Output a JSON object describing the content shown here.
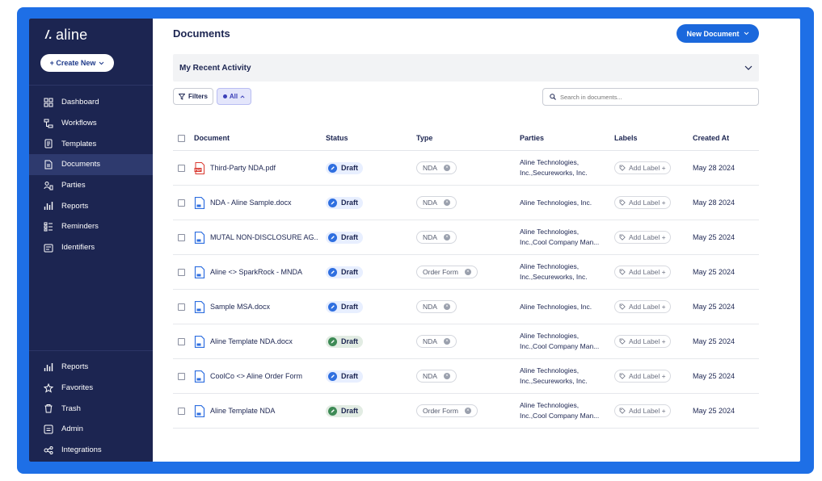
{
  "brand": {
    "name": "aline",
    "mark": "/."
  },
  "sidebar": {
    "create_label": "+ Create New",
    "top_items": [
      {
        "label": "Dashboard",
        "icon": "dashboard-icon",
        "active": false
      },
      {
        "label": "Workflows",
        "icon": "workflow-icon",
        "active": false
      },
      {
        "label": "Templates",
        "icon": "template-icon",
        "active": false
      },
      {
        "label": "Documents",
        "icon": "document-icon",
        "active": true
      },
      {
        "label": "Parties",
        "icon": "parties-icon",
        "active": false
      },
      {
        "label": "Reports",
        "icon": "reports-icon",
        "active": false
      },
      {
        "label": "Reminders",
        "icon": "reminders-icon",
        "active": false
      },
      {
        "label": "Identifiers",
        "icon": "identifiers-icon",
        "active": false
      }
    ],
    "bottom_items": [
      {
        "label": "Reports",
        "icon": "reports-icon"
      },
      {
        "label": "Favorites",
        "icon": "star-icon"
      },
      {
        "label": "Trash",
        "icon": "trash-icon"
      },
      {
        "label": "Admin",
        "icon": "admin-icon"
      },
      {
        "label": "Integrations",
        "icon": "integrations-icon"
      }
    ]
  },
  "header": {
    "title": "Documents",
    "new_doc_label": "New Document"
  },
  "recent": {
    "title": "My Recent Activity"
  },
  "toolbar": {
    "filters_label": "Filters",
    "all_label": "All",
    "search_placeholder": "Search in documents..."
  },
  "table": {
    "columns": [
      "Document",
      "Status",
      "Type",
      "Parties",
      "Labels",
      "Created At"
    ],
    "rows": [
      {
        "name": "Third-Party NDA.pdf",
        "file": "pdf",
        "status": "Draft",
        "status_color": "blue",
        "type": "NDA",
        "parties": [
          "Aline Technologies,",
          "Inc.,Secureworks, Inc."
        ],
        "label": "Add Label +",
        "created": "May 28 2024"
      },
      {
        "name": "NDA - Aline Sample.docx",
        "file": "doc",
        "status": "Draft",
        "status_color": "blue",
        "type": "NDA",
        "parties": [
          "Aline Technologies, Inc."
        ],
        "label": "Add Label +",
        "created": "May 28 2024"
      },
      {
        "name": "MUTAL NON-DISCLOSURE AG..",
        "file": "doc",
        "status": "Draft",
        "status_color": "blue",
        "type": "NDA",
        "parties": [
          "Aline Technologies,",
          "Inc.,Cool Company Man..."
        ],
        "label": "Add Label +",
        "created": "May 25 2024"
      },
      {
        "name": "Aline <> SparkRock - MNDA",
        "file": "doc",
        "status": "Draft",
        "status_color": "blue",
        "type": "Order Form",
        "parties": [
          "Aline Technologies,",
          "Inc.,Secureworks, Inc."
        ],
        "label": "Add Label +",
        "created": "May 25 2024"
      },
      {
        "name": "Sample MSA.docx",
        "file": "doc",
        "status": "Draft",
        "status_color": "blue",
        "type": "NDA",
        "parties": [
          "Aline Technologies, Inc."
        ],
        "label": "Add Label +",
        "created": "May 25 2024"
      },
      {
        "name": "Aline Template NDA.docx",
        "file": "doc",
        "status": "Draft",
        "status_color": "green",
        "type": "NDA",
        "parties": [
          "Aline Technologies,",
          "Inc.,Cool Company Man..."
        ],
        "label": "Add Label +",
        "created": "May 25 2024"
      },
      {
        "name": "CoolCo <> Aline Order Form",
        "file": "doc",
        "status": "Draft",
        "status_color": "blue",
        "type": "NDA",
        "parties": [
          "Aline Technologies,",
          "Inc.,Secureworks, Inc."
        ],
        "label": "Add Label +",
        "created": "May 25 2024"
      },
      {
        "name": "Aline Template NDA",
        "file": "doc",
        "status": "Draft",
        "status_color": "green",
        "type": "Order Form",
        "parties": [
          "Aline Technologies,",
          "Inc.,Cool Company Man..."
        ],
        "label": "Add Label +",
        "created": "May 25 2024"
      }
    ]
  },
  "colors": {
    "frame": "#1e6fe6",
    "sidebar": "#1c2551",
    "primary_button": "#1b68dc",
    "status_blue": "#2f6fe0",
    "status_green": "#3d8a55"
  }
}
